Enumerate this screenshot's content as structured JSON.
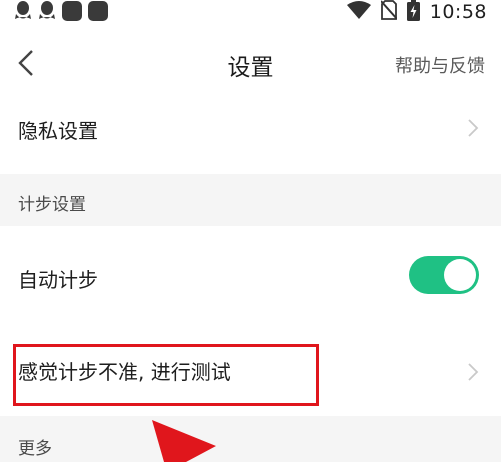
{
  "status_bar": {
    "time": "10:58",
    "icons": [
      "qq-icon",
      "qq-icon",
      "app-icon",
      "app-icon",
      "wifi-icon",
      "no-sim-icon",
      "battery-icon"
    ]
  },
  "header": {
    "title": "设置",
    "help_link": "帮助与反馈"
  },
  "rows": {
    "privacy": {
      "label": "隐私设置"
    },
    "auto_step": {
      "label": "自动计步",
      "enabled": true
    },
    "step_test": {
      "label": "感觉计步不准, 进行测试"
    }
  },
  "sections": {
    "step": "计步设置",
    "more": "更多"
  },
  "colors": {
    "toggle_on": "#1fc184",
    "highlight": "#e0161c",
    "section_bg": "#f5f5f5"
  }
}
